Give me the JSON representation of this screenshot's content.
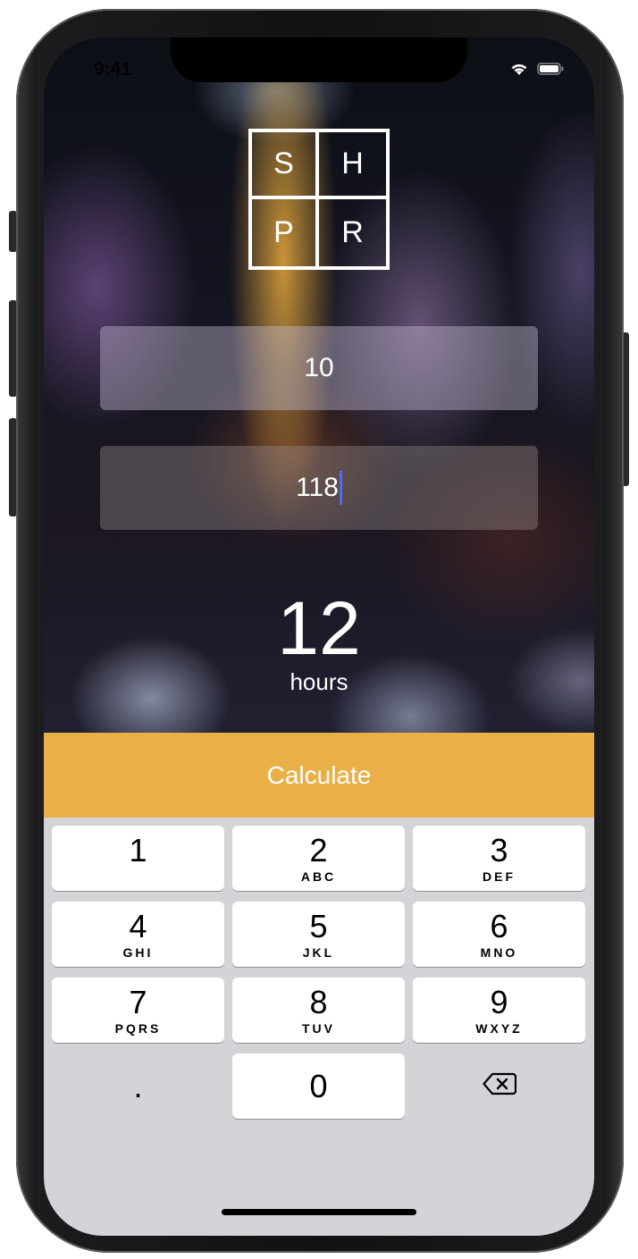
{
  "status_bar": {
    "time": "9:41"
  },
  "logo": {
    "letters": [
      "S",
      "H",
      "P",
      "R"
    ]
  },
  "inputs": {
    "first_value": "10",
    "second_value": "118"
  },
  "result": {
    "value": "12",
    "unit": "hours"
  },
  "actions": {
    "calculate_label": "Calculate"
  },
  "keypad": {
    "keys": [
      {
        "number": "1",
        "letters": ""
      },
      {
        "number": "2",
        "letters": "ABC"
      },
      {
        "number": "3",
        "letters": "DEF"
      },
      {
        "number": "4",
        "letters": "GHI"
      },
      {
        "number": "5",
        "letters": "JKL"
      },
      {
        "number": "6",
        "letters": "MNO"
      },
      {
        "number": "7",
        "letters": "PQRS"
      },
      {
        "number": "8",
        "letters": "TUV"
      },
      {
        "number": "9",
        "letters": "WXYZ"
      },
      {
        "number": ".",
        "letters": ""
      },
      {
        "number": "0",
        "letters": ""
      }
    ],
    "delete_icon": "delete-backspace-icon"
  },
  "colors": {
    "accent": "#e8b046",
    "caret": "#4a6cf7",
    "keyboard_bg": "#d3d3d8"
  }
}
